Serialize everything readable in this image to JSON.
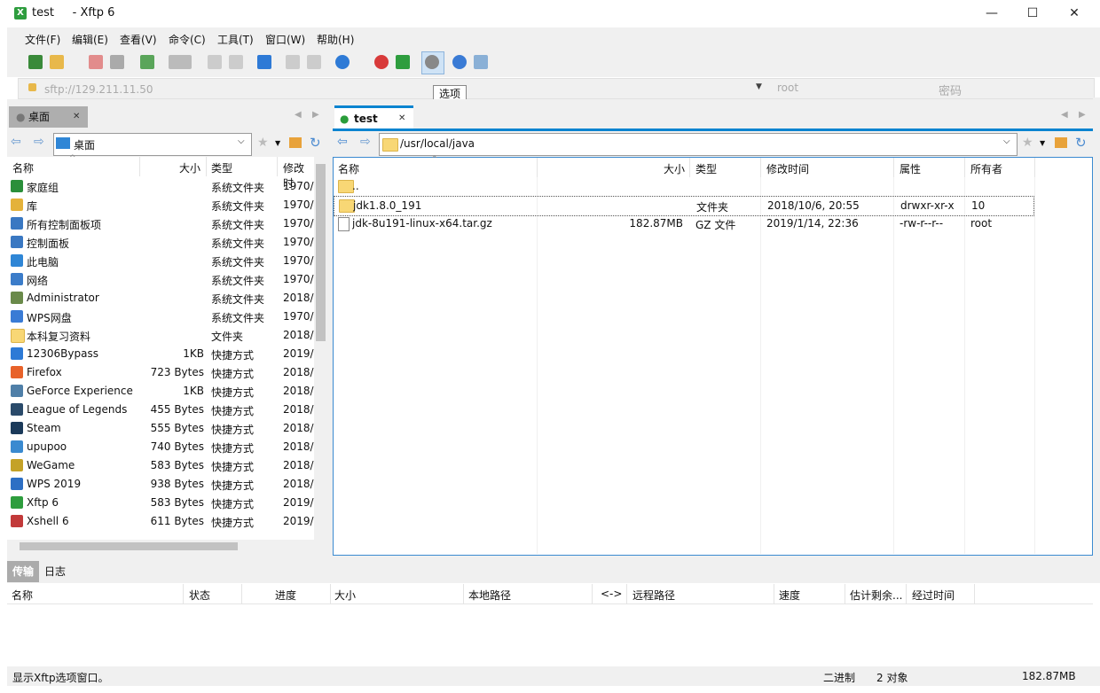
{
  "window": {
    "title": "test     - Xftp 6",
    "app_icon": "xftp-icon",
    "controls": {
      "minimize": "—",
      "maximize": "☐",
      "close": "✕"
    }
  },
  "menu": [
    "文件(F)",
    "编辑(E)",
    "查看(V)",
    "命令(C)",
    "工具(T)",
    "窗口(W)",
    "帮助(H)"
  ],
  "address": {
    "host": "sftp://129.211.11.50",
    "user_placeholder": "root",
    "password_placeholder": "密码"
  },
  "tooltip": "选项",
  "left_panel": {
    "tab_label": "桌面",
    "path": "桌面",
    "columns": [
      "名称",
      "大小",
      "类型",
      "修改时"
    ],
    "rows": [
      {
        "name": "家庭组",
        "size": "",
        "type": "系统文件夹",
        "modified": "1970/",
        "icon": "homegroup-icon",
        "color": "#2a8f3a"
      },
      {
        "name": "库",
        "size": "",
        "type": "系统文件夹",
        "modified": "1970/",
        "icon": "library-icon",
        "color": "#e4b23a"
      },
      {
        "name": "所有控制面板项",
        "size": "",
        "type": "系统文件夹",
        "modified": "1970/",
        "icon": "control-panel-icon",
        "color": "#3a78c2"
      },
      {
        "name": "控制面板",
        "size": "",
        "type": "系统文件夹",
        "modified": "1970/",
        "icon": "control-panel-icon",
        "color": "#3a78c2"
      },
      {
        "name": "此电脑",
        "size": "",
        "type": "系统文件夹",
        "modified": "1970/",
        "icon": "computer-icon",
        "color": "#2f86d6"
      },
      {
        "name": "网络",
        "size": "",
        "type": "系统文件夹",
        "modified": "1970/",
        "icon": "network-icon",
        "color": "#3b7cc9"
      },
      {
        "name": "Administrator",
        "size": "",
        "type": "系统文件夹",
        "modified": "2018/",
        "icon": "user-icon",
        "color": "#6a8a4a"
      },
      {
        "name": "WPS网盘",
        "size": "",
        "type": "系统文件夹",
        "modified": "1970/",
        "icon": "cloud-icon",
        "color": "#3a7bd5"
      },
      {
        "name": "本科复习资料",
        "size": "",
        "type": "文件夹",
        "modified": "2018/",
        "icon": "folder-icon",
        "color": "#f8d775"
      },
      {
        "name": "12306Bypass",
        "size": "1KB",
        "type": "快捷方式",
        "modified": "2019/",
        "icon": "app-12306-icon",
        "color": "#2d7ad6"
      },
      {
        "name": "Firefox",
        "size": "723 Bytes",
        "type": "快捷方式",
        "modified": "2018/",
        "icon": "firefox-icon",
        "color": "#e8622a"
      },
      {
        "name": "GeForce Experience",
        "size": "1KB",
        "type": "快捷方式",
        "modified": "2018/",
        "icon": "geforce-icon",
        "color": "#4f7fa8"
      },
      {
        "name": "League of Legends",
        "size": "455 Bytes",
        "type": "快捷方式",
        "modified": "2018/",
        "icon": "lol-icon",
        "color": "#2a4a6a"
      },
      {
        "name": "Steam",
        "size": "555 Bytes",
        "type": "快捷方式",
        "modified": "2018/",
        "icon": "steam-icon",
        "color": "#1b3a5a"
      },
      {
        "name": "upupoo",
        "size": "740 Bytes",
        "type": "快捷方式",
        "modified": "2018/",
        "icon": "upupoo-icon",
        "color": "#3a8ad0"
      },
      {
        "name": "WeGame",
        "size": "583 Bytes",
        "type": "快捷方式",
        "modified": "2018/",
        "icon": "wegame-icon",
        "color": "#c4a228"
      },
      {
        "name": "WPS 2019",
        "size": "938 Bytes",
        "type": "快捷方式",
        "modified": "2018/",
        "icon": "wps-icon",
        "color": "#2d6fc4"
      },
      {
        "name": "Xftp 6",
        "size": "583 Bytes",
        "type": "快捷方式",
        "modified": "2019/",
        "icon": "xftp-icon",
        "color": "#2e9d3e"
      },
      {
        "name": "Xshell 6",
        "size": "611 Bytes",
        "type": "快捷方式",
        "modified": "2019/",
        "icon": "xshell-icon",
        "color": "#c23a3a"
      }
    ]
  },
  "right_panel": {
    "tab_label": "test",
    "path": "/usr/local/java",
    "columns": [
      "名称",
      "大小",
      "类型",
      "修改时间",
      "属性",
      "所有者"
    ],
    "rows": [
      {
        "name": "..",
        "size": "",
        "type": "",
        "modified": "",
        "attr": "",
        "owner": "",
        "icon": "folder-icon"
      },
      {
        "name": "jdk1.8.0_191",
        "size": "",
        "type": "文件夹",
        "modified": "2018/10/6, 20:55",
        "attr": "drwxr-xr-x",
        "owner": "10",
        "icon": "folder-icon"
      },
      {
        "name": "jdk-8u191-linux-x64.tar.gz",
        "size": "182.87MB",
        "type": "GZ 文件",
        "modified": "2019/1/14, 22:36",
        "attr": "-rw-r--r--",
        "owner": "root",
        "icon": "file-icon"
      }
    ]
  },
  "transfer": {
    "tabs": [
      "传输",
      "日志"
    ],
    "columns": [
      "名称",
      "状态",
      "进度",
      "大小",
      "本地路径",
      "<->",
      "远程路径",
      "速度",
      "估计剩余...",
      "经过时间"
    ]
  },
  "status": {
    "message": "显示Xftp选项窗口。",
    "mode": "二进制",
    "count": "2 对象",
    "size": "182.87MB"
  }
}
